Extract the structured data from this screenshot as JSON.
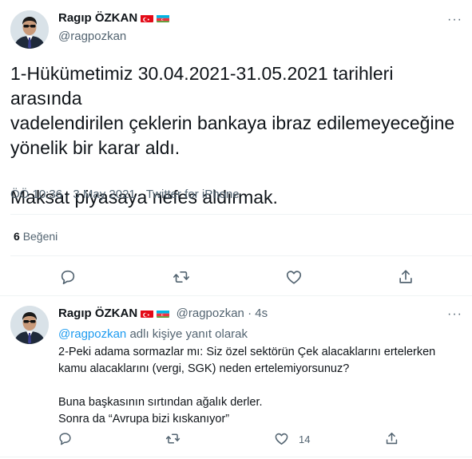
{
  "main_tweet": {
    "author_name": "Ragıp ÖZKAN",
    "author_handle": "@ragpozkan",
    "more_label": "···",
    "text_line1": "1-Hükümetimiz 30.04.2021-31.05.2021 tarihleri arasında",
    "text_line2": "vadelendirilen çeklerin bankaya ibraz edilemeyeceğine",
    "text_line3": "yönelik bir karar aldı.",
    "text_line4": "Maksat piyasaya nefes aldırmak.",
    "time": "ÖÖ 10:36",
    "separator": " · ",
    "date": "3 May 2021",
    "source": "Twitter for iPhone",
    "likes_count": "6",
    "likes_label": "Beğeni",
    "actions": [
      "reply-icon",
      "retweet-icon",
      "like-icon",
      "share-icon"
    ]
  },
  "reply_tweet": {
    "author_name": "Ragıp ÖZKAN",
    "author_handle": "@ragpozkan",
    "time": "4s",
    "separator": " · ",
    "replying_mention": "@ragpozkan",
    "replying_suffix": " adlı kişiye yanıt olarak",
    "text_line1": "2-Peki adama sormazlar mı: Siz özel sektörün Çek alacaklarını ertelerken",
    "text_line2": "kamu alacaklarını (vergi, SGK) neden ertelemiyorsunuz?",
    "text_line3": "Buna başkasının sırtından ağalık derler.",
    "text_line4": "Sonra da “Avrupa bizi kıskanıyor”",
    "like_count": "14",
    "more_label": "···"
  },
  "colors": {
    "text": "#0f1419",
    "muted": "#536471",
    "link": "#1d9bf0",
    "divider": "#eff3f4",
    "flag_turkey": "#e30a17",
    "flag_azerbaijan_blue": "#00b5e2",
    "flag_azerbaijan_red": "#ef3340",
    "flag_azerbaijan_green": "#509e2f"
  }
}
